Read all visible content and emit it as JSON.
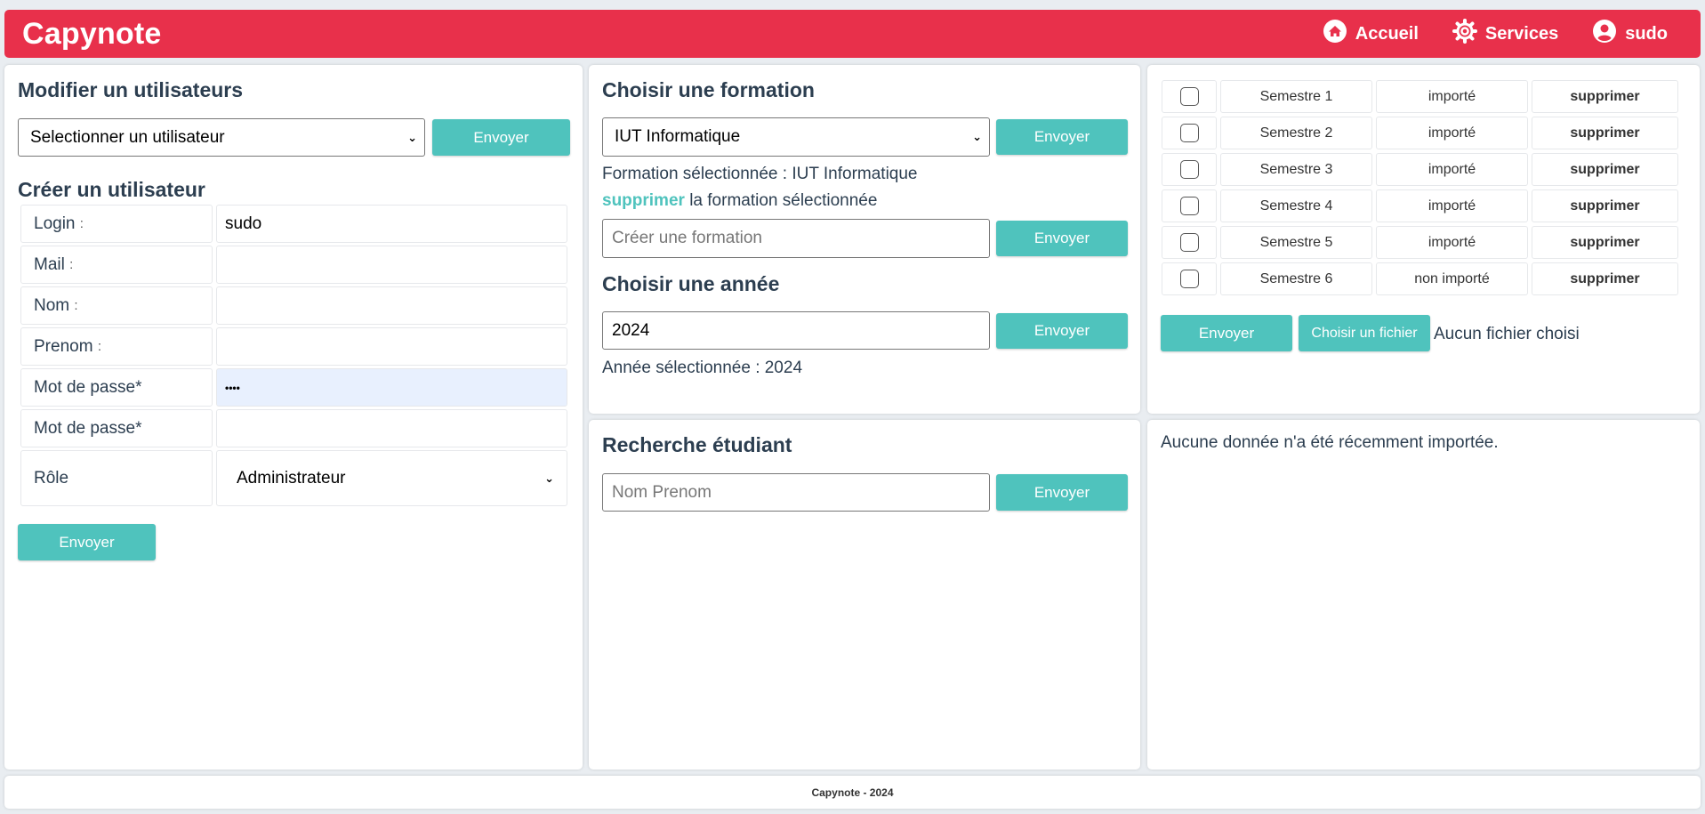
{
  "header": {
    "brand": "Capynote",
    "nav": {
      "home": "Accueil",
      "services": "Services",
      "user": "sudo"
    }
  },
  "left": {
    "modify_title": "Modifier un utilisateurs",
    "modify_select": "Selectionner un utilisateur",
    "modify_submit": "Envoyer",
    "create_title": "Créer un utilisateur",
    "fields": {
      "login_label": "Login",
      "login_value": "sudo",
      "mail_label": "Mail",
      "nom_label": "Nom",
      "prenom_label": "Prenom",
      "password_label": "Mot de passe*",
      "password_value": "••••",
      "password2_label": "Mot de passe*",
      "role_label": "Rôle",
      "role_value": "Administrateur"
    },
    "colon": ":",
    "create_submit": "Envoyer"
  },
  "formation": {
    "title": "Choisir une formation",
    "select_value": "IUT Informatique",
    "submit": "Envoyer",
    "selected_text": "Formation sélectionnée : IUT Informatique",
    "delete_link": "supprimer",
    "delete_text": " la formation sélectionnée",
    "create_placeholder": "Créer une formation",
    "create_submit": "Envoyer",
    "year_title": "Choisir une année",
    "year_value": "2024",
    "year_submit": "Envoyer",
    "year_selected_text": "Année sélectionnée : 2024"
  },
  "search": {
    "title": "Recherche étudiant",
    "placeholder": "Nom Prenom",
    "submit": "Envoyer"
  },
  "semesters": {
    "rows": [
      {
        "name": "Semestre 1",
        "status": "importé",
        "action": "supprimer"
      },
      {
        "name": "Semestre 2",
        "status": "importé",
        "action": "supprimer"
      },
      {
        "name": "Semestre 3",
        "status": "importé",
        "action": "supprimer"
      },
      {
        "name": "Semestre 4",
        "status": "importé",
        "action": "supprimer"
      },
      {
        "name": "Semestre 5",
        "status": "importé",
        "action": "supprimer"
      },
      {
        "name": "Semestre 6",
        "status": "non importé",
        "action": "supprimer"
      }
    ],
    "submit": "Envoyer",
    "file_button": "Choisir un fichier",
    "file_status": "Aucun fichier choisi"
  },
  "recent": {
    "message": "Aucune donnée n'a été récemment importée."
  },
  "footer": {
    "text": "Capynote - 2024"
  }
}
